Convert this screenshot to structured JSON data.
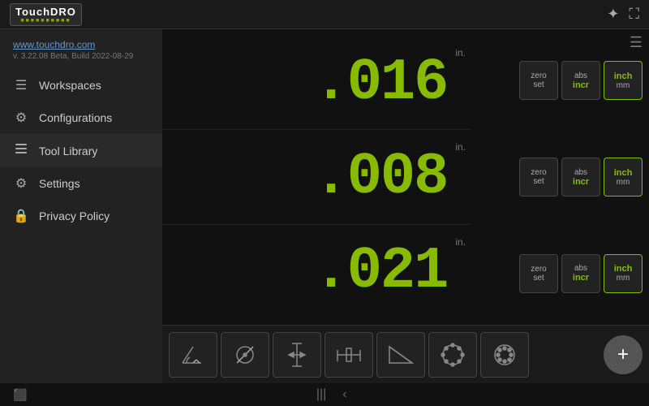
{
  "topbar": {
    "logo_text": "TouchDRO",
    "logo_dots": "■■■■■■■■■■",
    "icons": {
      "bluetooth": "✦",
      "fullscreen": "⛶"
    }
  },
  "sidebar": {
    "brand_link": "www.touchdro.com",
    "version": "v. 3.22.08 Beta, Build 2022-08-29",
    "items": [
      {
        "id": "workspaces",
        "label": "Workspaces",
        "icon": "☰"
      },
      {
        "id": "configurations",
        "label": "Configurations",
        "icon": "⚙"
      },
      {
        "id": "tool-library",
        "label": "Tool Library",
        "icon": "☰"
      },
      {
        "id": "settings",
        "label": "Settings",
        "icon": "⚙"
      },
      {
        "id": "privacy-policy",
        "label": "Privacy Policy",
        "icon": "🔒"
      }
    ]
  },
  "dro": {
    "rows": [
      {
        "value": ".016",
        "unit": "in."
      },
      {
        "value": ".008",
        "unit": "in."
      },
      {
        "value": ".021",
        "unit": "in."
      }
    ],
    "controls": [
      {
        "buttons": [
          {
            "id": "zero-set-1",
            "line1": "zero",
            "line2": "set",
            "active": false
          },
          {
            "id": "abs-incr-1",
            "line1": "abs",
            "line2": "incr",
            "active": false
          },
          {
            "id": "inch-mm-1",
            "line1": "inch",
            "line2": "mm",
            "active": true
          }
        ]
      },
      {
        "buttons": [
          {
            "id": "zero-set-2",
            "line1": "zero",
            "line2": "set",
            "active": false
          },
          {
            "id": "abs-incr-2",
            "line1": "abs",
            "line2": "incr",
            "active": false
          },
          {
            "id": "inch-mm-2",
            "line1": "inch",
            "line2": "mm",
            "active": true
          }
        ]
      },
      {
        "buttons": [
          {
            "id": "zero-set-3",
            "line1": "zero",
            "line2": "set",
            "active": false
          },
          {
            "id": "abs-incr-3",
            "line1": "abs",
            "line2": "incr",
            "active": false
          },
          {
            "id": "inch-mm-3",
            "line1": "inch",
            "line2": "mm",
            "active": true
          }
        ]
      }
    ],
    "menu_icon": "☰"
  },
  "toolbar": {
    "tools": [
      {
        "id": "tool-1",
        "label": "angle-tool"
      },
      {
        "id": "tool-2",
        "label": "circle-tool"
      },
      {
        "id": "tool-3",
        "label": "height-tool"
      },
      {
        "id": "tool-4",
        "label": "caliper-tool"
      },
      {
        "id": "tool-5",
        "label": "triangle-tool"
      },
      {
        "id": "tool-6",
        "label": "bolt-circle-tool"
      },
      {
        "id": "tool-7",
        "label": "hole-pattern-tool"
      }
    ],
    "fab_icon": "+"
  },
  "systembar": {
    "left_icon": "⬛",
    "nav_icons": [
      "|||",
      "<"
    ],
    "right_icon": ""
  }
}
